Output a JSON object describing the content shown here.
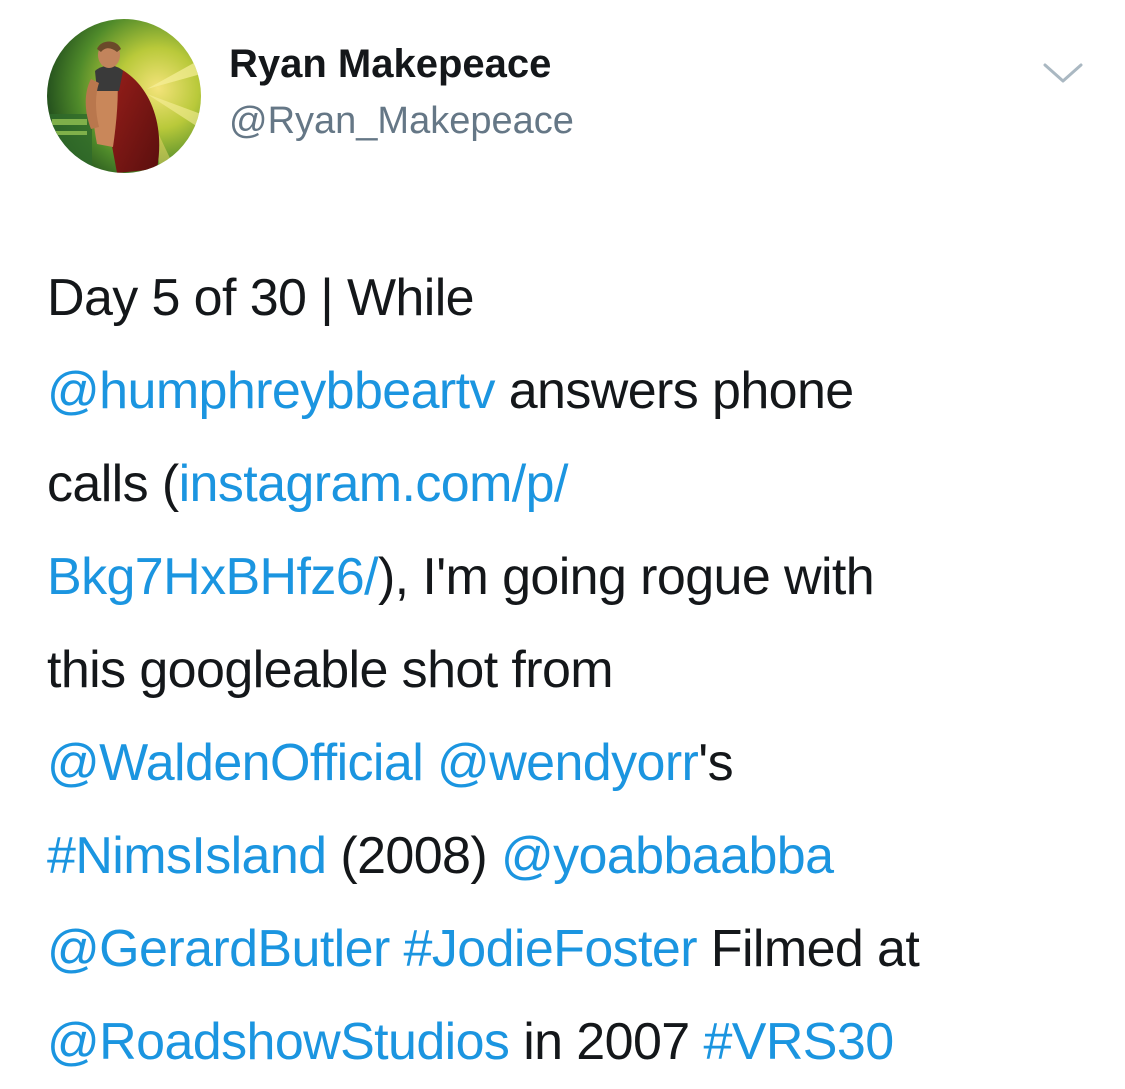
{
  "author": {
    "name": "Ryan Makepeace",
    "handle": "@Ryan_Makepeace"
  },
  "menu": {
    "icon": "chevron-down-icon"
  },
  "tweet": {
    "lines": [
      [
        {
          "type": "text",
          "text": "Day 5 of 30 | While"
        }
      ],
      [
        {
          "type": "mention",
          "text": "@humphreybbeartv"
        },
        {
          "type": "text",
          "text": " answers phone"
        }
      ],
      [
        {
          "type": "text",
          "text": "calls ("
        },
        {
          "type": "url",
          "text": "instagram.com/p/"
        }
      ],
      [
        {
          "type": "url",
          "text": "Bkg7HxBHfz6/"
        },
        {
          "type": "text",
          "text": "), I'm going rogue with"
        }
      ],
      [
        {
          "type": "text",
          "text": "this googleable shot from"
        }
      ],
      [
        {
          "type": "mention",
          "text": "@WaldenOfficial"
        },
        {
          "type": "text",
          "text": " "
        },
        {
          "type": "mention",
          "text": "@wendyorr"
        },
        {
          "type": "text",
          "text": "'s"
        }
      ],
      [
        {
          "type": "hashtag",
          "text": "#NimsIsland"
        },
        {
          "type": "text",
          "text": " (2008) "
        },
        {
          "type": "mention",
          "text": "@yoabbaabba"
        }
      ],
      [
        {
          "type": "mention",
          "text": "@GerardButler"
        },
        {
          "type": "text",
          "text": " "
        },
        {
          "type": "hashtag",
          "text": "#JodieFoster"
        },
        {
          "type": "text",
          "text": " Filmed at"
        }
      ],
      [
        {
          "type": "mention",
          "text": "@RoadshowStudios"
        },
        {
          "type": "text",
          "text": " in 2007 "
        },
        {
          "type": "hashtag",
          "text": "#VRS30"
        }
      ]
    ]
  },
  "colors": {
    "text": "#14171a",
    "secondary": "#657786",
    "link": "#1b95e0",
    "chevron": "#aab8c2"
  }
}
